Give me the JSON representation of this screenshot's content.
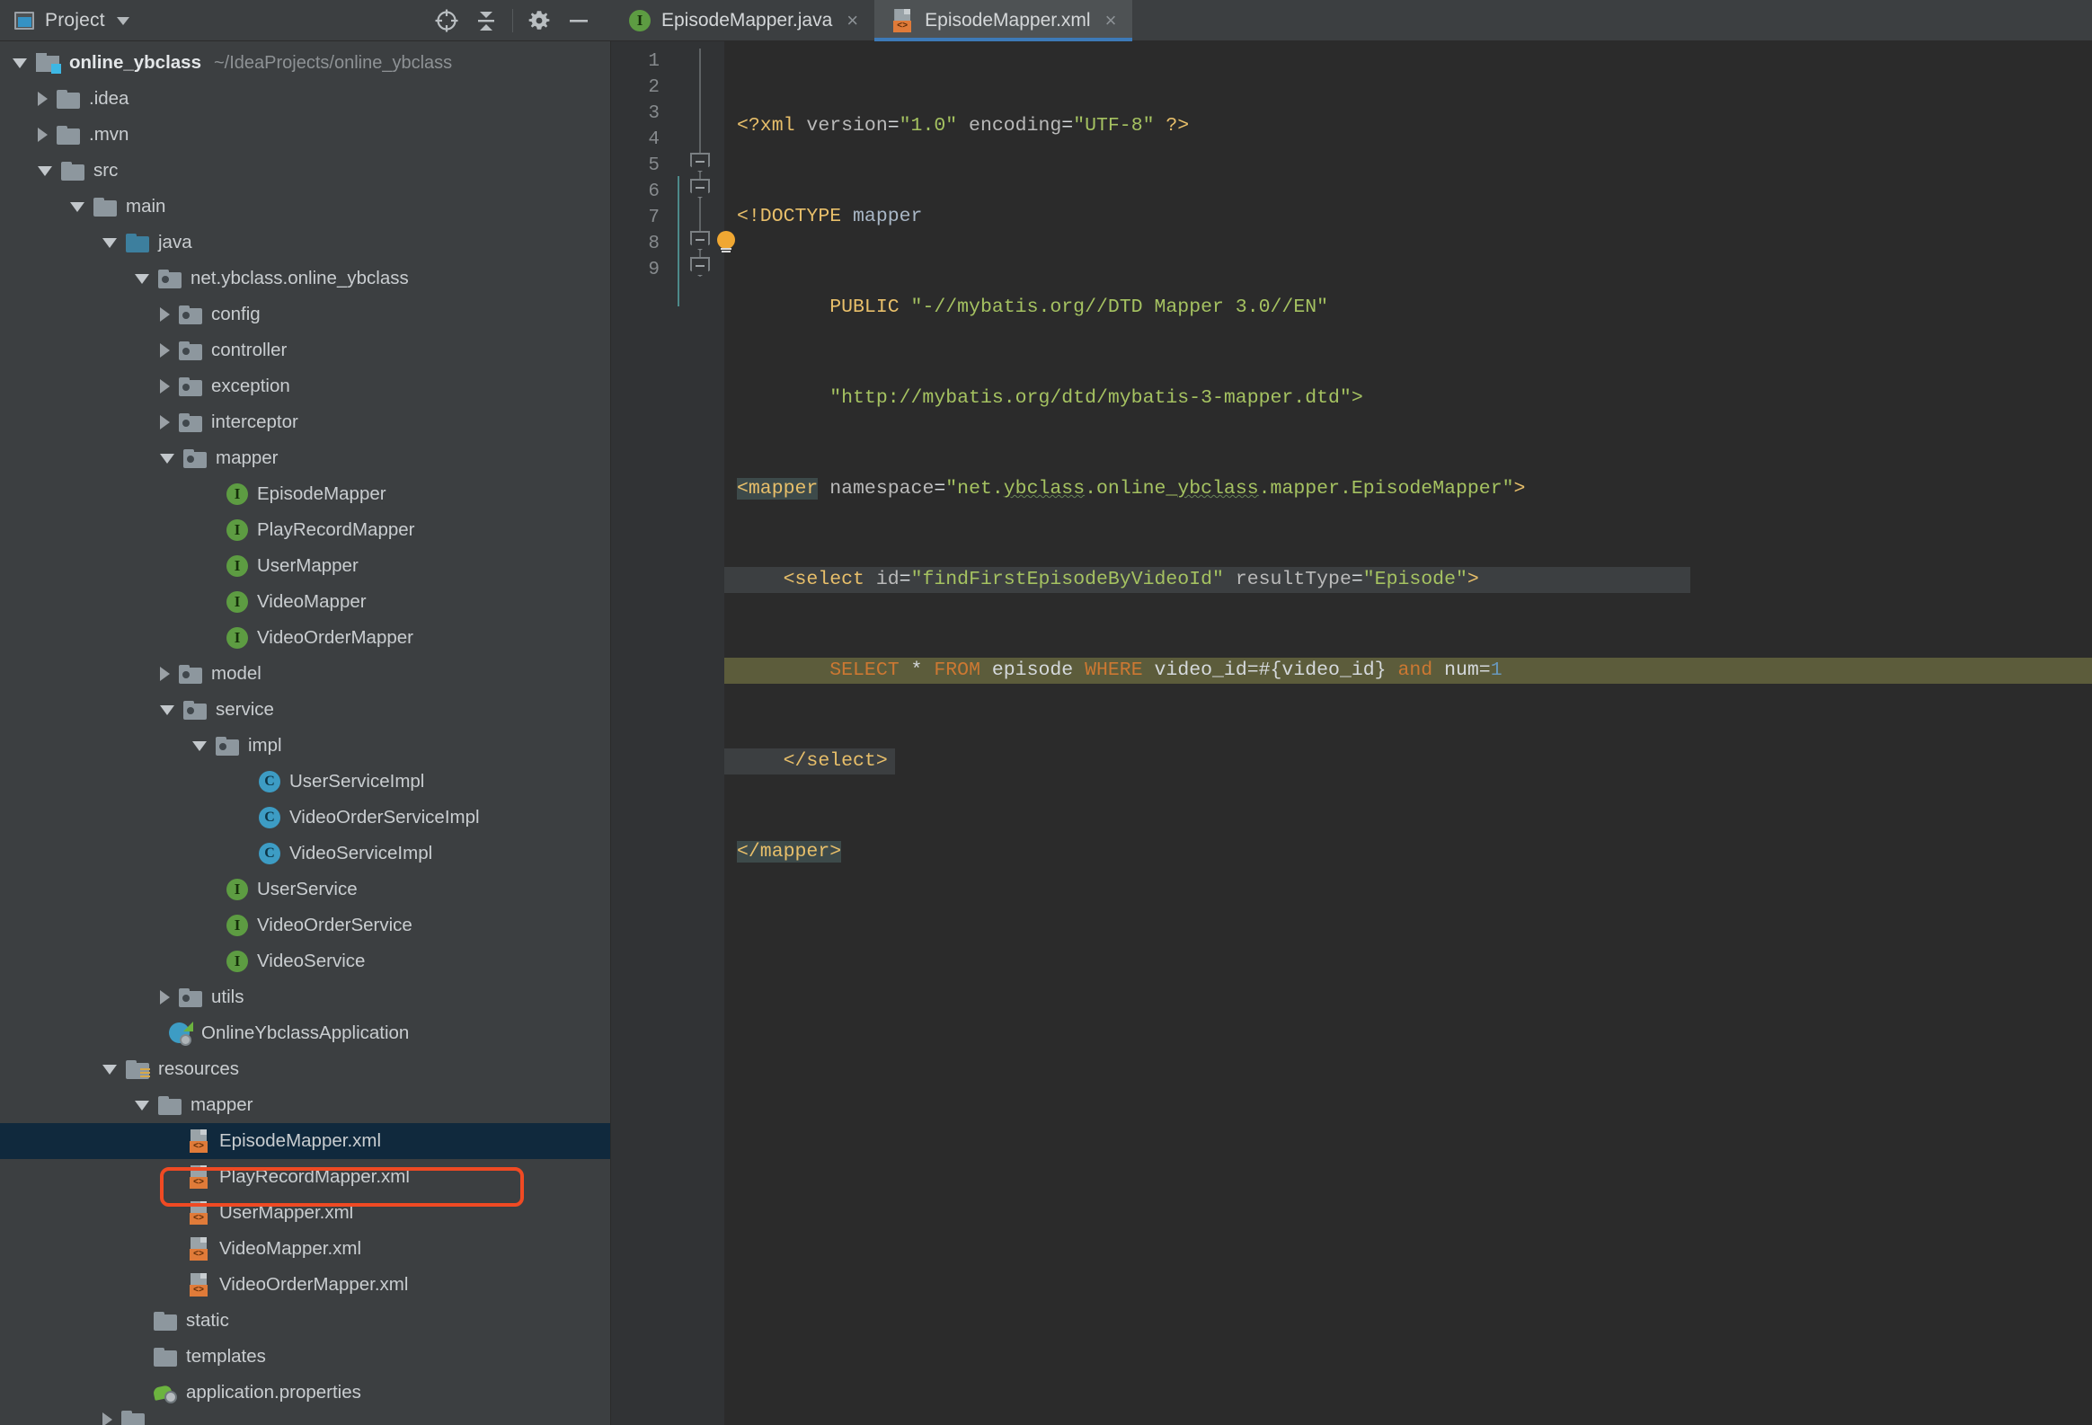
{
  "window": {
    "tool_window_title": "Project",
    "tool_window_icon": "project-view-icon",
    "actions": [
      {
        "name": "locate-icon",
        "label": "Select Opened File"
      },
      {
        "name": "collapse-all-icon",
        "label": "Collapse All"
      },
      {
        "name": "gear-icon",
        "label": "Settings"
      },
      {
        "name": "minimize-icon",
        "label": "Hide"
      }
    ]
  },
  "tabs": [
    {
      "label": "EpisodeMapper.java",
      "icon": "java-interface-icon",
      "active": false,
      "close": "×"
    },
    {
      "label": "EpisodeMapper.xml",
      "icon": "xml-file-icon",
      "active": true,
      "close": "×"
    }
  ],
  "project_tree": {
    "root": {
      "label": "online_ybclass",
      "path": "~/IdeaProjects/online_ybclass"
    },
    "items": [
      {
        "label": "online_ybclass",
        "path": "~/IdeaProjects/online_ybclass",
        "indent": 0,
        "arrow": "open",
        "icon": "module-icon",
        "bold": true
      },
      {
        "label": ".idea",
        "indent": 1,
        "arrow": "closed",
        "icon": "folder-icon"
      },
      {
        "label": ".mvn",
        "indent": 1,
        "arrow": "closed",
        "icon": "folder-icon"
      },
      {
        "label": "src",
        "indent": 1,
        "arrow": "open",
        "icon": "folder-icon"
      },
      {
        "label": "main",
        "indent": 2,
        "arrow": "open",
        "icon": "folder-icon"
      },
      {
        "label": "java",
        "indent": 3,
        "arrow": "open",
        "icon": "folder-source-icon"
      },
      {
        "label": "net.ybclass.online_ybclass",
        "indent": 4,
        "arrow": "open",
        "icon": "package-icon"
      },
      {
        "label": "config",
        "indent": 5,
        "arrow": "closed",
        "icon": "package-icon"
      },
      {
        "label": "controller",
        "indent": 5,
        "arrow": "closed",
        "icon": "package-icon"
      },
      {
        "label": "exception",
        "indent": 5,
        "arrow": "closed",
        "icon": "package-icon"
      },
      {
        "label": "interceptor",
        "indent": 5,
        "arrow": "closed",
        "icon": "package-icon"
      },
      {
        "label": "mapper",
        "indent": 5,
        "arrow": "open",
        "icon": "package-icon"
      },
      {
        "label": "EpisodeMapper",
        "indent": 6,
        "arrow": "none",
        "icon": "java-interface-icon"
      },
      {
        "label": "PlayRecordMapper",
        "indent": 6,
        "arrow": "none",
        "icon": "java-interface-icon"
      },
      {
        "label": "UserMapper",
        "indent": 6,
        "arrow": "none",
        "icon": "java-interface-icon"
      },
      {
        "label": "VideoMapper",
        "indent": 6,
        "arrow": "none",
        "icon": "java-interface-icon"
      },
      {
        "label": "VideoOrderMapper",
        "indent": 6,
        "arrow": "none",
        "icon": "java-interface-icon"
      },
      {
        "label": "model",
        "indent": 5,
        "arrow": "closed",
        "icon": "package-icon"
      },
      {
        "label": "service",
        "indent": 5,
        "arrow": "open",
        "icon": "package-icon"
      },
      {
        "label": "impl",
        "indent": 6,
        "arrow": "open",
        "icon": "package-icon"
      },
      {
        "label": "UserServiceImpl",
        "indent": 7,
        "arrow": "none",
        "icon": "java-class-icon"
      },
      {
        "label": "VideoOrderServiceImpl",
        "indent": 7,
        "arrow": "none",
        "icon": "java-class-icon"
      },
      {
        "label": "VideoServiceImpl",
        "indent": 7,
        "arrow": "none",
        "icon": "java-class-icon"
      },
      {
        "label": "UserService",
        "indent": 6,
        "arrow": "none",
        "icon": "java-interface-icon"
      },
      {
        "label": "VideoOrderService",
        "indent": 6,
        "arrow": "none",
        "icon": "java-interface-icon"
      },
      {
        "label": "VideoService",
        "indent": 6,
        "arrow": "none",
        "icon": "java-interface-icon"
      },
      {
        "label": "utils",
        "indent": 5,
        "arrow": "closed",
        "icon": "package-icon"
      },
      {
        "label": "OnlineYbclassApplication",
        "indent": 5,
        "arrow": "none",
        "icon": "spring-app-icon"
      },
      {
        "label": "resources",
        "indent": 3,
        "arrow": "open",
        "icon": "folder-resources-icon"
      },
      {
        "label": "mapper",
        "indent": 4,
        "arrow": "open",
        "icon": "folder-icon"
      },
      {
        "label": "EpisodeMapper.xml",
        "indent": 5,
        "arrow": "none",
        "icon": "xml-file-icon",
        "selected": true,
        "highlighted": true
      },
      {
        "label": "PlayRecordMapper.xml",
        "indent": 5,
        "arrow": "none",
        "icon": "xml-file-icon"
      },
      {
        "label": "UserMapper.xml",
        "indent": 5,
        "arrow": "none",
        "icon": "xml-file-icon"
      },
      {
        "label": "VideoMapper.xml",
        "indent": 5,
        "arrow": "none",
        "icon": "xml-file-icon"
      },
      {
        "label": "VideoOrderMapper.xml",
        "indent": 5,
        "arrow": "none",
        "icon": "xml-file-icon"
      },
      {
        "label": "static",
        "indent": 4,
        "arrow": "none",
        "icon": "folder-icon"
      },
      {
        "label": "templates",
        "indent": 4,
        "arrow": "none",
        "icon": "folder-icon"
      },
      {
        "label": "application.properties",
        "indent": 4,
        "arrow": "none",
        "icon": "properties-file-icon"
      }
    ]
  },
  "editor": {
    "line_numbers": [
      "1",
      "2",
      "3",
      "4",
      "5",
      "6",
      "7",
      "8",
      "9"
    ],
    "lines": {
      "l1_a": "<?xml",
      "l1_b": " version",
      "l1_c": "=",
      "l1_d": "\"1.0\"",
      "l1_e": " encoding",
      "l1_f": "=",
      "l1_g": "\"UTF-8\" ",
      "l1_h": "?>",
      "l2_a": "<!DOCTYPE",
      "l2_b": " mapper",
      "l3_a": "        PUBLIC ",
      "l3_b": "\"-//mybatis.org//DTD Mapper 3.0//EN\"",
      "l4_a": "        ",
      "l4_b": "\"http://mybatis.org/dtd/mybatis-3-mapper.dtd\">",
      "l5_a": "<mapper",
      "l5_b": " namespace",
      "l5_c": "=",
      "l5_d": "\"net.",
      "l5_e": "ybclass",
      "l5_f": ".online_",
      "l5_g": "ybclass",
      "l5_h": ".mapper.EpisodeMapper\"",
      "l5_i": ">",
      "l6_a": "    <select",
      "l6_b": " id",
      "l6_c": "=",
      "l6_d": "\"findFirstEpisodeByVideoId\"",
      "l6_e": " resultType",
      "l6_f": "=",
      "l6_g": "\"Episode\"",
      "l6_h": ">",
      "l7_a": "        ",
      "l7_b": "SELECT",
      "l7_c": " * ",
      "l7_d": "FROM",
      "l7_e": " episode ",
      "l7_f": "WHERE",
      "l7_g": " video_id=#{video_id} ",
      "l7_h": "and",
      "l7_i": " num=",
      "l7_j": "1",
      "l8_a": "    </select>",
      "l9_a": "</mapper>"
    },
    "gutter_markers": [
      {
        "name": "fold-marker-line5",
        "type": "fold-collapse"
      },
      {
        "name": "fold-marker-line6",
        "type": "fold-collapse"
      },
      {
        "name": "fold-marker-line8",
        "type": "fold-collapse"
      },
      {
        "name": "fold-marker-line9",
        "type": "fold-collapse"
      },
      {
        "name": "intention-bulb-icon",
        "type": "lightbulb"
      }
    ]
  },
  "colors": {
    "accent_selection_box": "#f04a23",
    "tree_selection_bg": "#10293d",
    "tab_active_underline": "#3d7ab8",
    "editor_bg": "#2b2b2b",
    "panel_bg": "#3c3f41"
  }
}
